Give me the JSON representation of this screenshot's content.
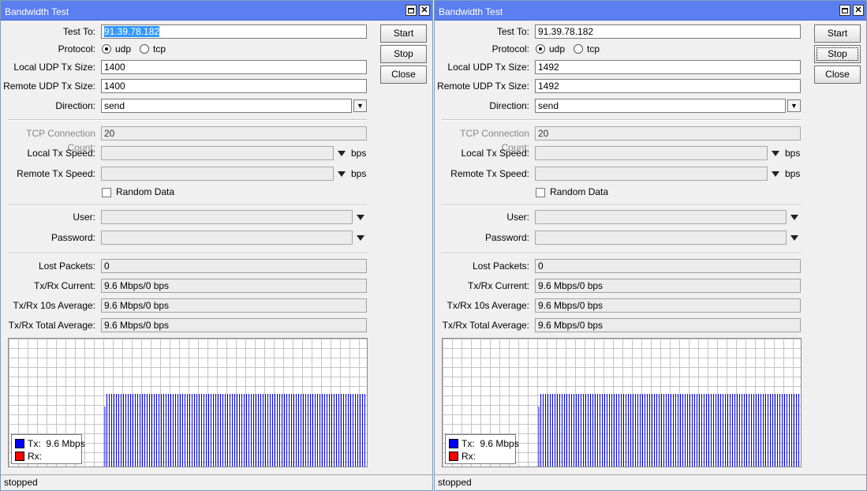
{
  "windows": [
    {
      "title": "Bandwidth Test",
      "labels": {
        "test_to": "Test To:",
        "protocol": "Protocol:",
        "local_udp": "Local UDP Tx Size:",
        "remote_udp": "Remote UDP Tx Size:",
        "direction": "Direction:",
        "tcp_count": "TCP Connection Count:",
        "local_tx_speed": "Local Tx Speed:",
        "remote_tx_speed": "Remote Tx Speed:",
        "random_data": "Random Data",
        "user": "User:",
        "password": "Password:",
        "lost_packets": "Lost Packets:",
        "txrx_current": "Tx/Rx Current:",
        "txrx_10s": "Tx/Rx 10s Average:",
        "txrx_total": "Tx/Rx Total Average:"
      },
      "values": {
        "test_to": "91.39.78.182",
        "protocol_udp": "udp",
        "protocol_tcp": "tcp",
        "protocol_selected": "udp",
        "local_udp": "1400",
        "remote_udp": "1400",
        "direction": "send",
        "tcp_count": "20",
        "local_tx_speed": "",
        "remote_tx_speed": "",
        "random_data_checked": false,
        "user": "",
        "password": "",
        "lost_packets": "0",
        "txrx_current": "9.6 Mbps/0 bps",
        "txrx_10s": "9.6 Mbps/0 bps",
        "txrx_total": "9.6 Mbps/0 bps"
      },
      "units": {
        "bps": "bps"
      },
      "buttons": {
        "start": "Start",
        "stop": "Stop",
        "close": "Close"
      },
      "legend": {
        "tx_label": "Tx:",
        "tx_value": "9.6 Mbps",
        "rx_label": "Rx:",
        "rx_value": ""
      },
      "status": "stopped",
      "colors": {
        "tx": "#0000ff",
        "rx": "#ff0000",
        "titlebar": "#5b7ff0"
      }
    },
    {
      "title": "Bandwidth Test",
      "labels": {
        "test_to": "Test To:",
        "protocol": "Protocol:",
        "local_udp": "Local UDP Tx Size:",
        "remote_udp": "Remote UDP Tx Size:",
        "direction": "Direction:",
        "tcp_count": "TCP Connection Count:",
        "local_tx_speed": "Local Tx Speed:",
        "remote_tx_speed": "Remote Tx Speed:",
        "random_data": "Random Data",
        "user": "User:",
        "password": "Password:",
        "lost_packets": "Lost Packets:",
        "txrx_current": "Tx/Rx Current:",
        "txrx_10s": "Tx/Rx 10s Average:",
        "txrx_total": "Tx/Rx Total Average:"
      },
      "values": {
        "test_to": "91.39.78.182",
        "protocol_udp": "udp",
        "protocol_tcp": "tcp",
        "protocol_selected": "udp",
        "local_udp": "1492",
        "remote_udp": "1492",
        "direction": "send",
        "tcp_count": "20",
        "local_tx_speed": "",
        "remote_tx_speed": "",
        "random_data_checked": false,
        "user": "",
        "password": "",
        "lost_packets": "0",
        "txrx_current": "9.6 Mbps/0 bps",
        "txrx_10s": "9.6 Mbps/0 bps",
        "txrx_total": "9.6 Mbps/0 bps"
      },
      "units": {
        "bps": "bps"
      },
      "buttons": {
        "start": "Start",
        "stop": "Stop",
        "close": "Close"
      },
      "legend": {
        "tx_label": "Tx:",
        "tx_value": "9.6 Mbps",
        "rx_label": "Rx:",
        "rx_value": ""
      },
      "status": "stopped",
      "colors": {
        "tx": "#0000ff",
        "rx": "#ff0000",
        "titlebar": "#5b7ff0"
      }
    }
  ]
}
